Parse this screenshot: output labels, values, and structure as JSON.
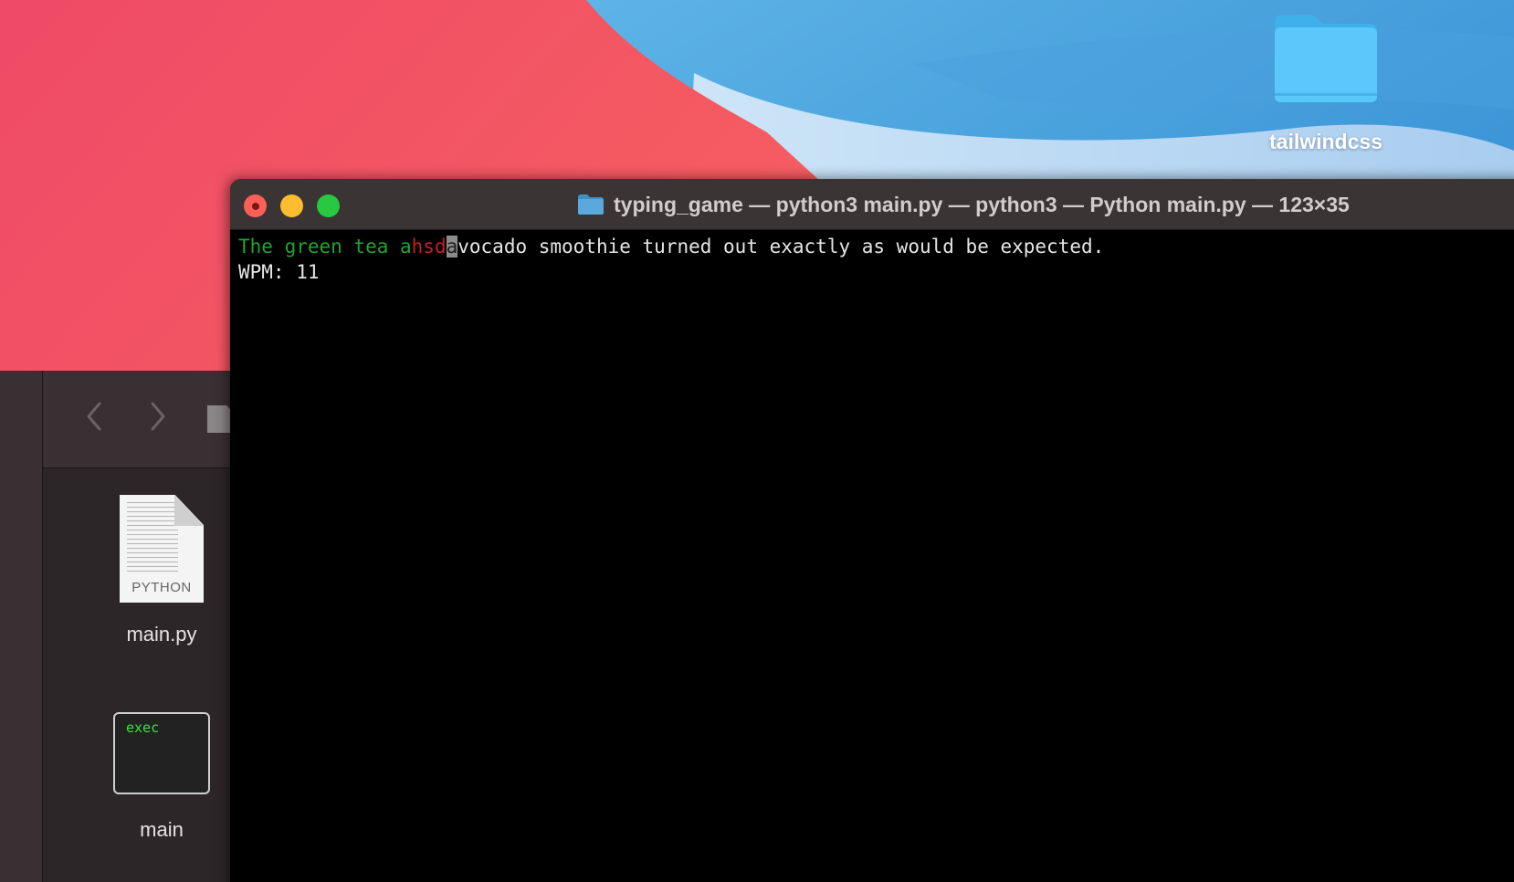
{
  "desktop": {
    "folder": {
      "label": "tailwindcss",
      "icon": "folder-icon",
      "color": "#5ac8fa"
    }
  },
  "finder": {
    "files": [
      {
        "label": "main.py",
        "icon": "python-file-icon",
        "type_label": "PYTHON"
      },
      {
        "label": "main",
        "icon": "exec-file-icon",
        "type_label": "exec"
      }
    ]
  },
  "terminal": {
    "title": "typing_game — python3 main.py — python3 — Python main.py — 123×35",
    "title_icon": "folder-icon",
    "typing": {
      "correct": "The green tea a",
      "incorrect": "hsd",
      "cursor": "a",
      "remaining": "vocado smoothie turned out exactly as would be expected."
    },
    "wpm": "WPM: 11"
  },
  "colors": {
    "correct": "#20a52d",
    "incorrect": "#c81e25",
    "terminal_bg": "#000000",
    "titlebar_bg": "#3b3434"
  }
}
